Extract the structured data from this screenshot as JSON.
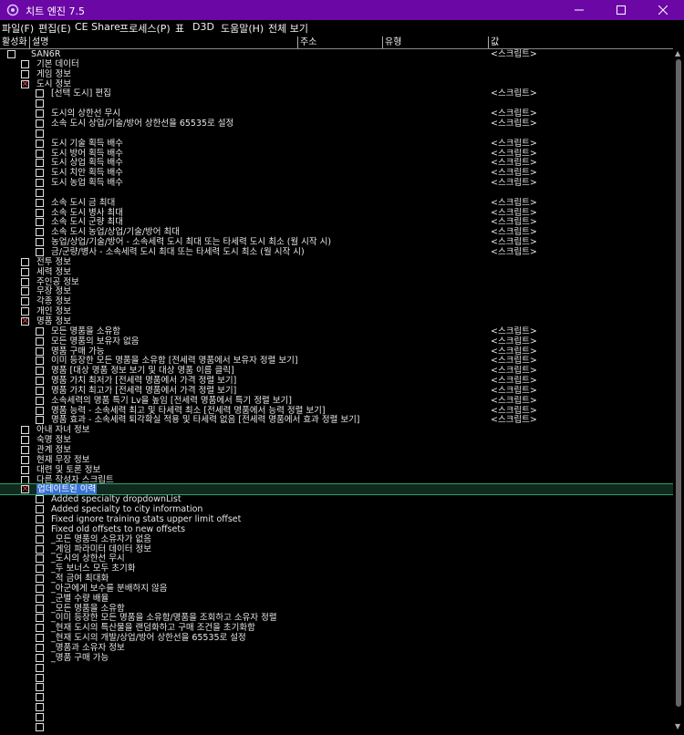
{
  "window": {
    "title": "치트 엔진 7.5",
    "colors": {
      "titlebar": "#6b07a5",
      "background": "#000000",
      "checkmark": "#e04040",
      "selection": "#3a72d6"
    }
  },
  "menu": [
    "파일(F)",
    "편집(E)",
    "CE Share",
    "프로세스(P)",
    "표",
    "D3D",
    "도움말(H)",
    "전체 보기"
  ],
  "columns": [
    "활성화",
    "설명",
    "주소",
    "유형",
    "값"
  ],
  "rows": [
    {
      "indent": 0,
      "checked": false,
      "desc": "SAN6R",
      "val": "<스크립트>"
    },
    {
      "indent": 1,
      "checked": false,
      "desc": "기본 데이터",
      "val": ""
    },
    {
      "indent": 1,
      "checked": false,
      "desc": "게임 정보",
      "val": ""
    },
    {
      "indent": 1,
      "checked": true,
      "desc": "도시 정보",
      "val": ""
    },
    {
      "indent": 2,
      "checked": false,
      "desc": "[선택 도시] 편집",
      "val": "<스크립트>"
    },
    {
      "indent": 2,
      "checked": false,
      "desc": "",
      "val": ""
    },
    {
      "indent": 2,
      "checked": false,
      "desc": "도시의 상한선 무시",
      "val": "<스크립트>"
    },
    {
      "indent": 2,
      "checked": false,
      "desc": "소속 도시 상업/기술/방어 상한선을 65535로 설정",
      "val": "<스크립트>"
    },
    {
      "indent": 2,
      "checked": false,
      "desc": "",
      "val": ""
    },
    {
      "indent": 2,
      "checked": false,
      "desc": "도시 기술 획득 배수",
      "val": "<스크립트>"
    },
    {
      "indent": 2,
      "checked": false,
      "desc": "도시 방어 획득 배수",
      "val": "<스크립트>"
    },
    {
      "indent": 2,
      "checked": false,
      "desc": "도시 상업 획득 배수",
      "val": "<스크립트>"
    },
    {
      "indent": 2,
      "checked": false,
      "desc": "도시 치안 획득 배수",
      "val": "<스크립트>"
    },
    {
      "indent": 2,
      "checked": false,
      "desc": "도시 농업 획득 배수",
      "val": "<스크립트>"
    },
    {
      "indent": 2,
      "checked": false,
      "desc": "",
      "val": ""
    },
    {
      "indent": 2,
      "checked": false,
      "desc": "소속 도시 금 최대",
      "val": "<스크립트>"
    },
    {
      "indent": 2,
      "checked": false,
      "desc": "소속 도시 병사 최대",
      "val": "<스크립트>"
    },
    {
      "indent": 2,
      "checked": false,
      "desc": "소속 도시 군량 최대",
      "val": "<스크립트>"
    },
    {
      "indent": 2,
      "checked": false,
      "desc": "소속 도시 농업/상업/기술/방어 최대",
      "val": "<스크립트>"
    },
    {
      "indent": 2,
      "checked": false,
      "desc": "농업/상업/기술/방어 - 소속세력 도시 최대 또는 타세력 도시 최소 (월 시작 시)",
      "val": "<스크립트>"
    },
    {
      "indent": 2,
      "checked": false,
      "desc": "금/군량/병사 - 소속세력 도시 최대 또는 타세력 도시 최소 (월 시작 시)",
      "val": "<스크립트>"
    },
    {
      "indent": 1,
      "checked": false,
      "desc": "전투 정보",
      "val": ""
    },
    {
      "indent": 1,
      "checked": false,
      "desc": "세력 정보",
      "val": ""
    },
    {
      "indent": 1,
      "checked": false,
      "desc": "주인공 정보",
      "val": ""
    },
    {
      "indent": 1,
      "checked": false,
      "desc": "무장 정보",
      "val": ""
    },
    {
      "indent": 1,
      "checked": false,
      "desc": "각종 정보",
      "val": ""
    },
    {
      "indent": 1,
      "checked": false,
      "desc": "개인 정보",
      "val": ""
    },
    {
      "indent": 1,
      "checked": true,
      "desc": "명품 정보",
      "val": ""
    },
    {
      "indent": 2,
      "checked": false,
      "desc": "모든 명품을 소유함",
      "val": "<스크립트>"
    },
    {
      "indent": 2,
      "checked": false,
      "desc": "모든 명품의 보유자 없음",
      "val": "<스크립트>"
    },
    {
      "indent": 2,
      "checked": false,
      "desc": "명품 구매 가능",
      "val": "<스크립트>"
    },
    {
      "indent": 2,
      "checked": false,
      "desc": "이미 등장한 모든 명품을 소유함 [전세력 명품에서 보유자 정렬 보기]",
      "val": "<스크립트>"
    },
    {
      "indent": 2,
      "checked": false,
      "desc": "명품 [대상 명품 정보 보기 및 대상 명품 이름 클릭]",
      "val": "<스크립트>"
    },
    {
      "indent": 2,
      "checked": false,
      "desc": "명품 가치 최저가 [전세력 명품에서 가격 정렬 보기]",
      "val": "<스크립트>"
    },
    {
      "indent": 2,
      "checked": false,
      "desc": "명품 가치 최고가 [전세력 명품에서 가격 정렬 보기]",
      "val": "<스크립트>"
    },
    {
      "indent": 2,
      "checked": false,
      "desc": "소속세력의 명품 특기 Lv을 높임 [전세력 명품에서 특기 정렬 보기]",
      "val": "<스크립트>"
    },
    {
      "indent": 2,
      "checked": false,
      "desc": "명품 능력 - 소속세력 최고 및 타세력 최소 [전세력 명품에서 능력 정렬 보기]",
      "val": "<스크립트>"
    },
    {
      "indent": 2,
      "checked": false,
      "desc": "명품 효과 - 소속세력 퇴각확실 적용 및 타세력 없음 [전세력 명품에서 효과 정렬 보기]",
      "val": "<스크립트>"
    },
    {
      "indent": 1,
      "checked": false,
      "desc": "아내 자녀 정보",
      "val": ""
    },
    {
      "indent": 1,
      "checked": false,
      "desc": "숙명 정보",
      "val": ""
    },
    {
      "indent": 1,
      "checked": false,
      "desc": "관계 정보",
      "val": ""
    },
    {
      "indent": 1,
      "checked": false,
      "desc": "현재 무장 정보",
      "val": ""
    },
    {
      "indent": 1,
      "checked": false,
      "desc": "대련 및 토론 정보",
      "val": ""
    },
    {
      "indent": 1,
      "checked": false,
      "desc": "다른 작성자 스크립트",
      "val": ""
    },
    {
      "indent": 1,
      "checked": true,
      "desc": "업데이트된 이력",
      "val": "",
      "selected": true
    },
    {
      "indent": 2,
      "checked": false,
      "desc": "Added specialty dropdownList",
      "val": ""
    },
    {
      "indent": 2,
      "checked": false,
      "desc": "Added specialty to city information",
      "val": ""
    },
    {
      "indent": 2,
      "checked": false,
      "desc": "Fixed ignore training stats upper limit offset",
      "val": ""
    },
    {
      "indent": 2,
      "checked": false,
      "desc": "Fixed old offsets to new offsets",
      "val": ""
    },
    {
      "indent": 2,
      "checked": false,
      "desc": "_모든 명품의 소유자가 없음",
      "val": ""
    },
    {
      "indent": 2,
      "checked": false,
      "desc": "_게임 파라미터 데이터 정보",
      "val": ""
    },
    {
      "indent": 2,
      "checked": false,
      "desc": "_도시의 상한선 무시",
      "val": ""
    },
    {
      "indent": 2,
      "checked": false,
      "desc": "_두 보너스 모두 초기화",
      "val": ""
    },
    {
      "indent": 2,
      "checked": false,
      "desc": "_적 금여 최대화",
      "val": ""
    },
    {
      "indent": 2,
      "checked": false,
      "desc": "_아군에게 보수를 분배하지 않음",
      "val": ""
    },
    {
      "indent": 2,
      "checked": false,
      "desc": "_군별 수량 배율",
      "val": ""
    },
    {
      "indent": 2,
      "checked": false,
      "desc": "_모든 명품을 소유함",
      "val": ""
    },
    {
      "indent": 2,
      "checked": false,
      "desc": "_이미 등장한 모든 명품을 소유함/명품을 조회하고 소유자 정렬",
      "val": ""
    },
    {
      "indent": 2,
      "checked": false,
      "desc": "_현재 도시의 특산물을 랜덤화하고 구매 조건을 초기화함",
      "val": ""
    },
    {
      "indent": 2,
      "checked": false,
      "desc": "_현재 도시의 개발/상업/방어 상한선을 65535로 설정",
      "val": ""
    },
    {
      "indent": 2,
      "checked": false,
      "desc": "_명품과 소유자 정보",
      "val": ""
    },
    {
      "indent": 2,
      "checked": false,
      "desc": "_명품 구매 가능",
      "val": ""
    },
    {
      "indent": 2,
      "checked": false,
      "desc": "",
      "val": ""
    },
    {
      "indent": 2,
      "checked": false,
      "desc": "",
      "val": ""
    },
    {
      "indent": 2,
      "checked": false,
      "desc": "",
      "val": ""
    },
    {
      "indent": 2,
      "checked": false,
      "desc": "",
      "val": ""
    },
    {
      "indent": 2,
      "checked": false,
      "desc": "",
      "val": ""
    },
    {
      "indent": 2,
      "checked": false,
      "desc": "",
      "val": ""
    },
    {
      "indent": 2,
      "checked": false,
      "desc": "",
      "val": ""
    }
  ]
}
